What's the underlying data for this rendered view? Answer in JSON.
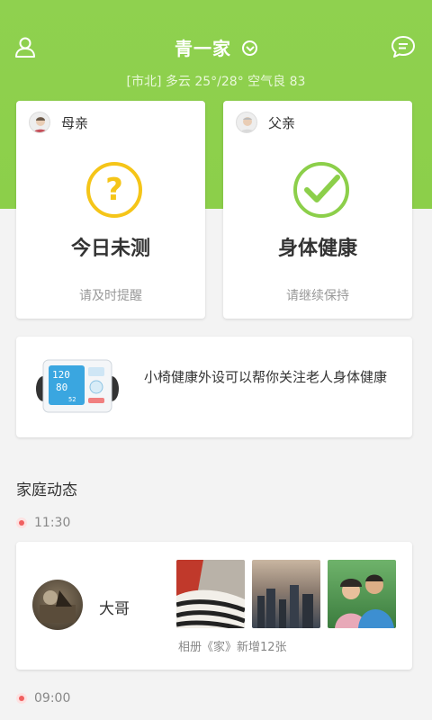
{
  "header": {
    "title": "青一家",
    "weather": "[市北] 多云 25°/28°  空气良 83"
  },
  "members": [
    {
      "name": "母亲",
      "status": "今日未测",
      "sub": "请及时提醒",
      "status_icon": "question-icon",
      "color": "#f5c518"
    },
    {
      "name": "父亲",
      "status": "身体健康",
      "sub": "请继续保持",
      "status_icon": "check-icon",
      "color": "#8ccf4a"
    }
  ],
  "promo": {
    "text": "小椅健康外设可以帮你关注老人身体健康",
    "device_readings": {
      "sys": "120",
      "dia": "80",
      "pulse": "52"
    }
  },
  "feed": {
    "section_title": "家庭动态",
    "items": [
      {
        "time": "11:30",
        "user": "大哥",
        "caption": "相册《家》新增12张"
      },
      {
        "time": "09:00"
      }
    ]
  },
  "colors": {
    "brand_green": "#8ccf4a",
    "warning_yellow": "#f5c518",
    "timeline_red": "#f06060"
  }
}
